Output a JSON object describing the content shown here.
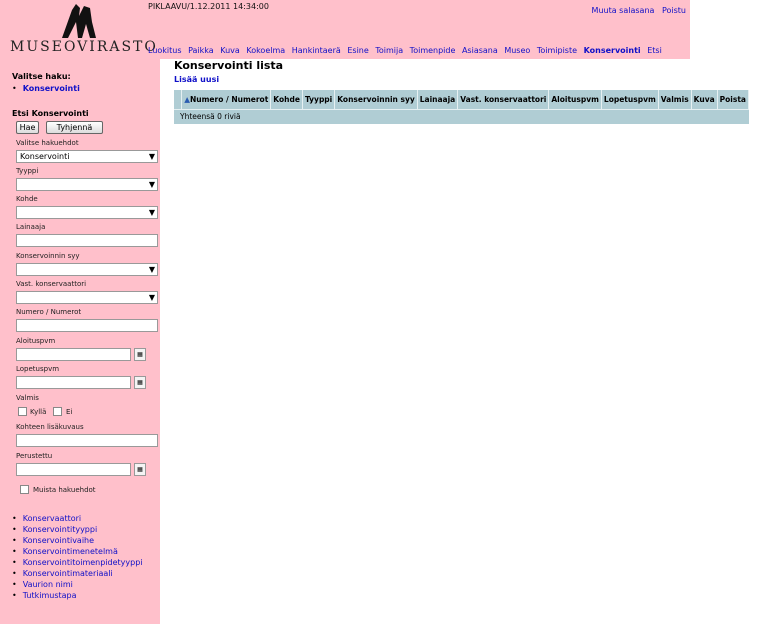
{
  "header": {
    "logo_text": "MUSEOVIRASTO",
    "stamp": "PIKLAAVU/1.12.2011 14:34:00",
    "top_links": [
      "Muuta salasana",
      "Poistu"
    ],
    "nav": [
      "Luokitus",
      "Paikka",
      "Kuva",
      "Kokoelma",
      "Hankintaerä",
      "Esine",
      "Toimija",
      "Toimenpide",
      "Asiasana",
      "Museo",
      "Toimipiste",
      "Konservointi",
      "Etsi"
    ],
    "active_nav": "Konservointi"
  },
  "sidebar": {
    "select_title": "Valitse haku:",
    "selected_search": "Konservointi",
    "search_title": "Etsi Konservointi",
    "search_button": "Hae",
    "clear_button": "Tyhjennä",
    "criteria_label": "Valitse hakuehdot",
    "criteria_value": "Konservointi",
    "type_label": "Tyyppi",
    "type_value": "",
    "target_label": "Kohde",
    "target_value": "",
    "lender_label": "Lainaaja",
    "lender_value": "",
    "reason_label": "Konservoinnin syy",
    "reason_value": "",
    "conservator_label": "Vast. konservaattori",
    "conservator_value": "",
    "number_label": "Numero / Numerot",
    "number_value": "",
    "start_label": "Aloituspvm",
    "start_value": "",
    "end_label": "Lopetuspvm",
    "end_value": "",
    "ready_label": "Valmis",
    "ready_yes": "Kyllä",
    "ready_no": "Ei",
    "extra_label": "Kohteen lisäkuvaus",
    "extra_value": "",
    "founded_label": "Perustettu",
    "founded_value": "",
    "other_criteria": "Muista hakuehdot",
    "links": [
      "Konservaattori",
      "Konservointityyppi",
      "Konservointivaihe",
      "Konservointimenetelmä",
      "Konservointitoimenpidetyyppi",
      "Konservointimateriaali",
      "Vaurion nimi",
      "Tutkimustapa"
    ]
  },
  "main": {
    "title": "Konservointi lista",
    "add_new": "Lisää uusi",
    "columns": [
      "Numero / Numerot",
      "Kohde",
      "Tyyppi",
      "Konservoinnin syy",
      "Lainaaja",
      "Vast. konservaattori",
      "Aloituspvm",
      "Lopetuspvm",
      "Valmis",
      "Kuva",
      "Poista"
    ],
    "total_text": "Yhteensä 0 riviä"
  },
  "colors": {
    "pink": "#ffc0cb",
    "table_header": "#b0cdd4",
    "link": "#1010c8"
  }
}
